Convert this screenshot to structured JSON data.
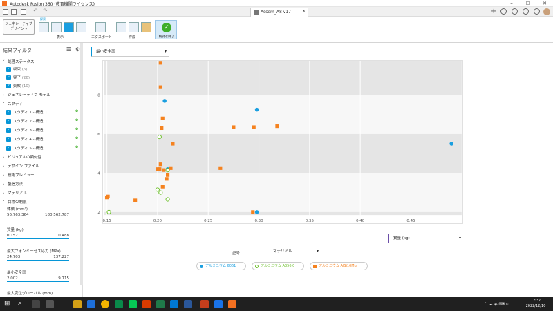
{
  "window": {
    "title": "Autodesk Fusion 360 (教育機関ライセンス)",
    "doc_tab": "Assem_A8 v17"
  },
  "ribbon": {
    "workspace": "ジェネレーティブ デザイン",
    "explore_tab": "探索",
    "group_display": "表示",
    "group_export": "エクスポート",
    "group_create": "作成",
    "finish_button": "検討を終了"
  },
  "left_panel": {
    "title": "結果フィルタ",
    "sections": {
      "status": "処理ステータス",
      "generative_model": "ジェネレーティブ モデル",
      "study": "スタディ",
      "visual_similarity": "ビジュアルの類似性",
      "design_file": "デザイン ファイル",
      "tech_preview": "技術プレビュー",
      "manufacturing": "製造方法",
      "material": "マテリアル",
      "objective_limits": "目標の制限"
    },
    "status_items": [
      {
        "label": "収束",
        "count": "(6)"
      },
      {
        "label": "完了",
        "count": "(26)"
      },
      {
        "label": "失敗",
        "count": "(10)"
      }
    ],
    "study_items": [
      "スタディ 1 - 構造コ...",
      "スタディ 2 - 構造コ...",
      "スタディ 3 - 構造",
      "スタディ 4 - 構造",
      "スタディ 5 - 構造"
    ],
    "ranges": [
      {
        "label": "体積 (mm³)",
        "min": "56,763.364",
        "max": "180,562.787"
      },
      {
        "label": "質量 (kg)",
        "min": "0.152",
        "max": "0.488"
      },
      {
        "label": "最大フォンミーゼス応力 (MPa)",
        "min": "24.703",
        "max": "137.227"
      },
      {
        "label": "最小安全率",
        "min": "2.002",
        "max": "9.715"
      },
      {
        "label": "最大変位グローバル (mm)",
        "min": "",
        "max": ""
      }
    ]
  },
  "chart_controls": {
    "y_metric": "最小安全率",
    "x_metric": "質量 (kg)",
    "legend_title": "記号",
    "legend_by": "マテリアル"
  },
  "legend": [
    {
      "name": "アルミニウム 6061",
      "color": "#1a9fe0",
      "shape": "circle"
    },
    {
      "name": "アルミニウム A356.0",
      "color": "#6cbf2a",
      "shape": "ring"
    },
    {
      "name": "アルミニウム AlSi10Mg",
      "color": "#f5821f",
      "shape": "square"
    }
  ],
  "chart_data": {
    "type": "scatter",
    "xlabel": "質量 (kg)",
    "ylabel": "最小安全率",
    "xlim": [
      0.147,
      0.5
    ],
    "ylim": [
      1.85,
      9.75
    ],
    "xticks": [
      0.15,
      0.2,
      0.25,
      0.3,
      0.35,
      0.4,
      0.45
    ],
    "yticks": [
      2,
      4,
      6,
      8
    ],
    "series": [
      {
        "name": "アルミニウム 6061",
        "marker": "circle",
        "color": "#1a9fe0",
        "points": [
          [
            0.207,
            7.7
          ],
          [
            0.298,
            7.25
          ],
          [
            0.49,
            5.5
          ],
          [
            0.21,
            4.2
          ],
          [
            0.298,
            2.0
          ]
        ]
      },
      {
        "name": "アルミニウム A356.0",
        "marker": "ring",
        "color": "#6cbf2a",
        "points": [
          [
            0.202,
            5.85
          ],
          [
            0.21,
            4.15
          ],
          [
            0.203,
            3.0
          ],
          [
            0.21,
            2.65
          ],
          [
            0.152,
            2.0
          ],
          [
            0.2,
            3.15
          ]
        ]
      },
      {
        "name": "アルミニウム AlSi10Mg",
        "marker": "square",
        "color": "#f5821f",
        "points": [
          [
            0.203,
            9.65
          ],
          [
            0.203,
            8.4
          ],
          [
            0.205,
            6.8
          ],
          [
            0.204,
            6.3
          ],
          [
            0.215,
            5.5
          ],
          [
            0.203,
            4.45
          ],
          [
            0.202,
            4.2
          ],
          [
            0.206,
            4.15
          ],
          [
            0.21,
            3.9
          ],
          [
            0.213,
            4.25
          ],
          [
            0.209,
            3.7
          ],
          [
            0.205,
            3.3
          ],
          [
            0.151,
            2.8
          ],
          [
            0.15,
            2.75
          ],
          [
            0.178,
            2.6
          ],
          [
            0.262,
            4.25
          ],
          [
            0.275,
            6.35
          ],
          [
            0.295,
            6.35
          ],
          [
            0.318,
            6.4
          ],
          [
            0.294,
            2.0
          ],
          [
            0.2,
            4.2
          ]
        ]
      }
    ],
    "grid": true
  },
  "taskbar": {
    "time": "12:37",
    "date": "2022/12/10"
  }
}
